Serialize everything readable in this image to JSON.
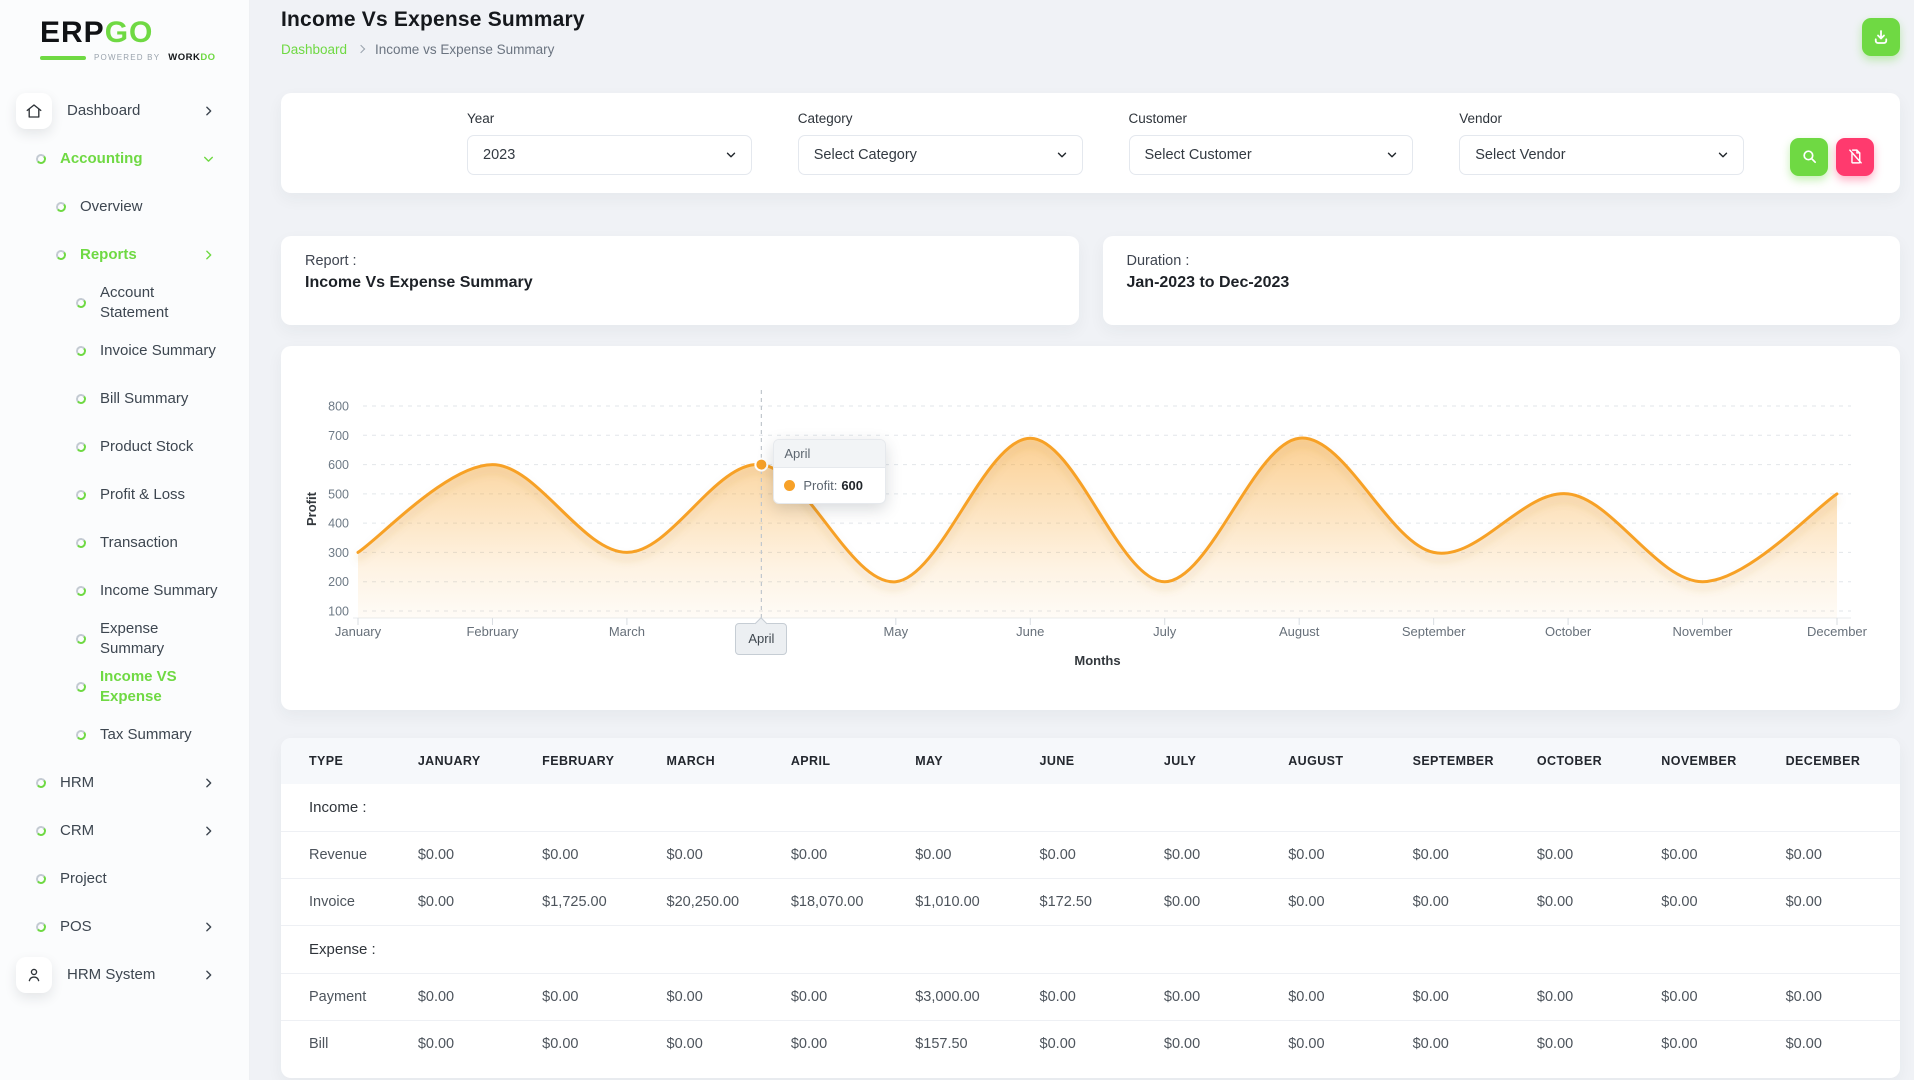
{
  "app": {
    "logo_erp": "ERP",
    "logo_go": "GO",
    "powered_by": "Powered By",
    "brand_work": "WORK",
    "brand_do": "DO"
  },
  "colors": {
    "accent_green": "#6fd943",
    "danger_pink": "#ff3a6e",
    "chart_line": "#f7a128",
    "grid": "#e2e6ea"
  },
  "sidebar": {
    "items": [
      {
        "label": "Dashboard",
        "icon": "home",
        "level": 0,
        "chevron": "right",
        "active": false,
        "wrap": false
      },
      {
        "label": "Accounting",
        "icon": "ring",
        "level": 1,
        "chevron": "down",
        "active": true,
        "wrap": false
      },
      {
        "label": "Overview",
        "icon": "ring",
        "level": 2,
        "chevron": "",
        "active": false,
        "wrap": false
      },
      {
        "label": "Reports",
        "icon": "ring",
        "level": 2,
        "chevron": "right",
        "active": true,
        "wrap": false
      },
      {
        "label": "Account Statement",
        "icon": "ring",
        "level": 3,
        "chevron": "",
        "active": false,
        "wrap": true
      },
      {
        "label": "Invoice Summary",
        "icon": "ring",
        "level": 3,
        "chevron": "",
        "active": false,
        "wrap": false
      },
      {
        "label": "Bill Summary",
        "icon": "ring",
        "level": 3,
        "chevron": "",
        "active": false,
        "wrap": false
      },
      {
        "label": "Product Stock",
        "icon": "ring",
        "level": 3,
        "chevron": "",
        "active": false,
        "wrap": false
      },
      {
        "label": "Profit & Loss",
        "icon": "ring",
        "level": 3,
        "chevron": "",
        "active": false,
        "wrap": false
      },
      {
        "label": "Transaction",
        "icon": "ring",
        "level": 3,
        "chevron": "",
        "active": false,
        "wrap": false
      },
      {
        "label": "Income Summary",
        "icon": "ring",
        "level": 3,
        "chevron": "",
        "active": false,
        "wrap": false
      },
      {
        "label": "Expense Summary",
        "icon": "ring",
        "level": 3,
        "chevron": "",
        "active": false,
        "wrap": true
      },
      {
        "label": "Income VS Expense",
        "icon": "ring",
        "level": 3,
        "chevron": "",
        "active": true,
        "wrap": true
      },
      {
        "label": "Tax Summary",
        "icon": "ring",
        "level": 3,
        "chevron": "",
        "active": false,
        "wrap": false
      },
      {
        "label": "HRM",
        "icon": "ring",
        "level": 1,
        "chevron": "right",
        "active": false,
        "wrap": false
      },
      {
        "label": "CRM",
        "icon": "ring",
        "level": 1,
        "chevron": "right",
        "active": false,
        "wrap": false
      },
      {
        "label": "Project",
        "icon": "ring",
        "level": 1,
        "chevron": "",
        "active": false,
        "wrap": false
      },
      {
        "label": "POS",
        "icon": "ring",
        "level": 1,
        "chevron": "right",
        "active": false,
        "wrap": false
      },
      {
        "label": "HRM System",
        "icon": "user",
        "level": 0,
        "chevron": "right",
        "active": false,
        "wrap": false
      }
    ]
  },
  "header": {
    "title": "Income Vs Expense Summary",
    "breadcrumb": {
      "home": "Dashboard",
      "current": "Income vs Expense Summary"
    }
  },
  "filters": {
    "year": {
      "label": "Year",
      "value": "2023"
    },
    "category": {
      "label": "Category",
      "value": "Select Category"
    },
    "customer": {
      "label": "Customer",
      "value": "Select Customer"
    },
    "vendor": {
      "label": "Vendor",
      "value": "Select Vendor"
    }
  },
  "info_cards": {
    "report": {
      "label": "Report :",
      "value": "Income Vs Expense Summary"
    },
    "duration": {
      "label": "Duration :",
      "value": "Jan-2023 to Dec-2023"
    }
  },
  "chart_data": {
    "type": "area",
    "categories": [
      "January",
      "February",
      "March",
      "April",
      "May",
      "June",
      "July",
      "August",
      "September",
      "October",
      "November",
      "December"
    ],
    "series": [
      {
        "name": "Profit",
        "values": [
          300,
          600,
          300,
          600,
          200,
          690,
          200,
          690,
          300,
          500,
          200,
          500
        ]
      }
    ],
    "xlabel": "Months",
    "ylabel": "Profit",
    "ylim": [
      100,
      800
    ],
    "yticks": [
      100,
      200,
      300,
      400,
      500,
      600,
      700,
      800
    ],
    "grid": "dashed horizontal",
    "legend": "none",
    "tooltip": {
      "category": "April",
      "index": 3,
      "series_label": "Profit:",
      "value": "600"
    }
  },
  "table": {
    "columns": [
      "TYPE",
      "JANUARY",
      "FEBRUARY",
      "MARCH",
      "APRIL",
      "MAY",
      "JUNE",
      "JULY",
      "AUGUST",
      "SEPTEMBER",
      "OCTOBER",
      "NOVEMBER",
      "DECEMBER"
    ],
    "sections": [
      {
        "label": "Income :",
        "rows": [
          {
            "type": "Revenue",
            "values": [
              "$0.00",
              "$0.00",
              "$0.00",
              "$0.00",
              "$0.00",
              "$0.00",
              "$0.00",
              "$0.00",
              "$0.00",
              "$0.00",
              "$0.00",
              "$0.00"
            ]
          },
          {
            "type": "Invoice",
            "values": [
              "$0.00",
              "$1,725.00",
              "$20,250.00",
              "$18,070.00",
              "$1,010.00",
              "$172.50",
              "$0.00",
              "$0.00",
              "$0.00",
              "$0.00",
              "$0.00",
              "$0.00"
            ]
          }
        ]
      },
      {
        "label": "Expense :",
        "rows": [
          {
            "type": "Payment",
            "values": [
              "$0.00",
              "$0.00",
              "$0.00",
              "$0.00",
              "$3,000.00",
              "$0.00",
              "$0.00",
              "$0.00",
              "$0.00",
              "$0.00",
              "$0.00",
              "$0.00"
            ]
          },
          {
            "type": "Bill",
            "values": [
              "$0.00",
              "$0.00",
              "$0.00",
              "$0.00",
              "$157.50",
              "$0.00",
              "$0.00",
              "$0.00",
              "$0.00",
              "$0.00",
              "$0.00",
              "$0.00"
            ]
          }
        ]
      }
    ]
  }
}
